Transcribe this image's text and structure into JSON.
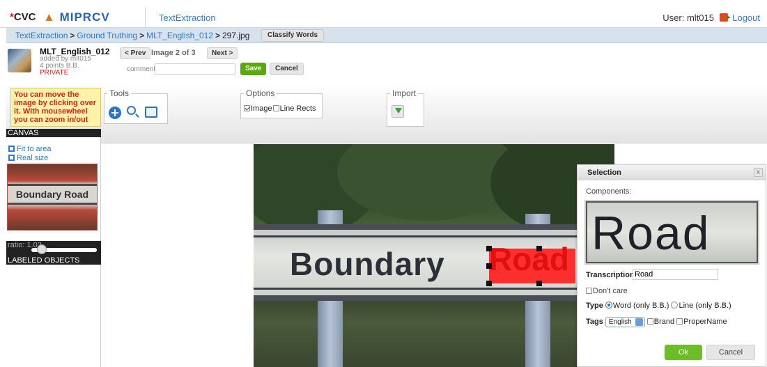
{
  "header": {
    "logo_cvc": "CVC",
    "logo_miprcv": "MIPRCV",
    "app_name": "TextExtraction",
    "user_label": "User: mlt015",
    "logout_label": "Logout"
  },
  "breadcrumb": {
    "items": [
      "TextExtraction",
      "Ground Truthing",
      "MLT_English_012",
      "297.jpg"
    ],
    "classify_label": "Classify Words"
  },
  "dataset": {
    "title": "MLT_English_012",
    "added_by": "added by mlt015",
    "points": "4 points B.B.",
    "privacy": "PRIVATE"
  },
  "image_nav": {
    "prev_label": "< Prev",
    "position": "Image 2 of 3",
    "next_label": "Next >"
  },
  "comments": {
    "label": "comments:",
    "value": "",
    "save_label": "Save",
    "cancel_label": "Cancel"
  },
  "help_note": "You can move the image by clicking over it. With mousewheel you can zoom in/out",
  "tools": {
    "legend": "Tools",
    "icons": [
      "add-icon",
      "zoom-icon",
      "fit-icon"
    ]
  },
  "options": {
    "legend": "Options",
    "image_label": "Image",
    "image_checked": true,
    "line_rects_label": "Line Rects",
    "line_rects_checked": false
  },
  "import": {
    "legend": "Import",
    "icon": "import-icon"
  },
  "left_panel": {
    "canvas_header": "CANVAS",
    "fit_label": "Fit to area",
    "real_label": "Real size",
    "preview_text": "Boundary Road",
    "ratio_label": "ratio: 1.02",
    "ratio_value": 1.02,
    "labeled_header": "LABELED OBJECTS"
  },
  "canvas": {
    "sign_text": "Boundary",
    "selected_word": "Road"
  },
  "selection_dialog": {
    "title": "Selection",
    "close_label": "x",
    "components_label": "Components:",
    "component_word": "Road",
    "transcription_label": "Transcription:",
    "transcription_value": "Road",
    "dont_care_label": "Don't care",
    "dont_care_checked": false,
    "type_label": "Type",
    "type_word_label": "Word (only B.B.)",
    "type_line_label": "Line (only B.B.)",
    "type_selected": "word",
    "tags_label": "Tags",
    "language": "English",
    "brand_label": "Brand",
    "proper_name_label": "ProperName",
    "ok_label": "Ok",
    "cancel_label": "Cancel"
  },
  "colors": {
    "accent": "#2a7bd2",
    "save_green": "#5aa80c",
    "ok_green": "#6dbd2a",
    "warning_red": "#e0201a",
    "selection_red": "#ff2020"
  }
}
